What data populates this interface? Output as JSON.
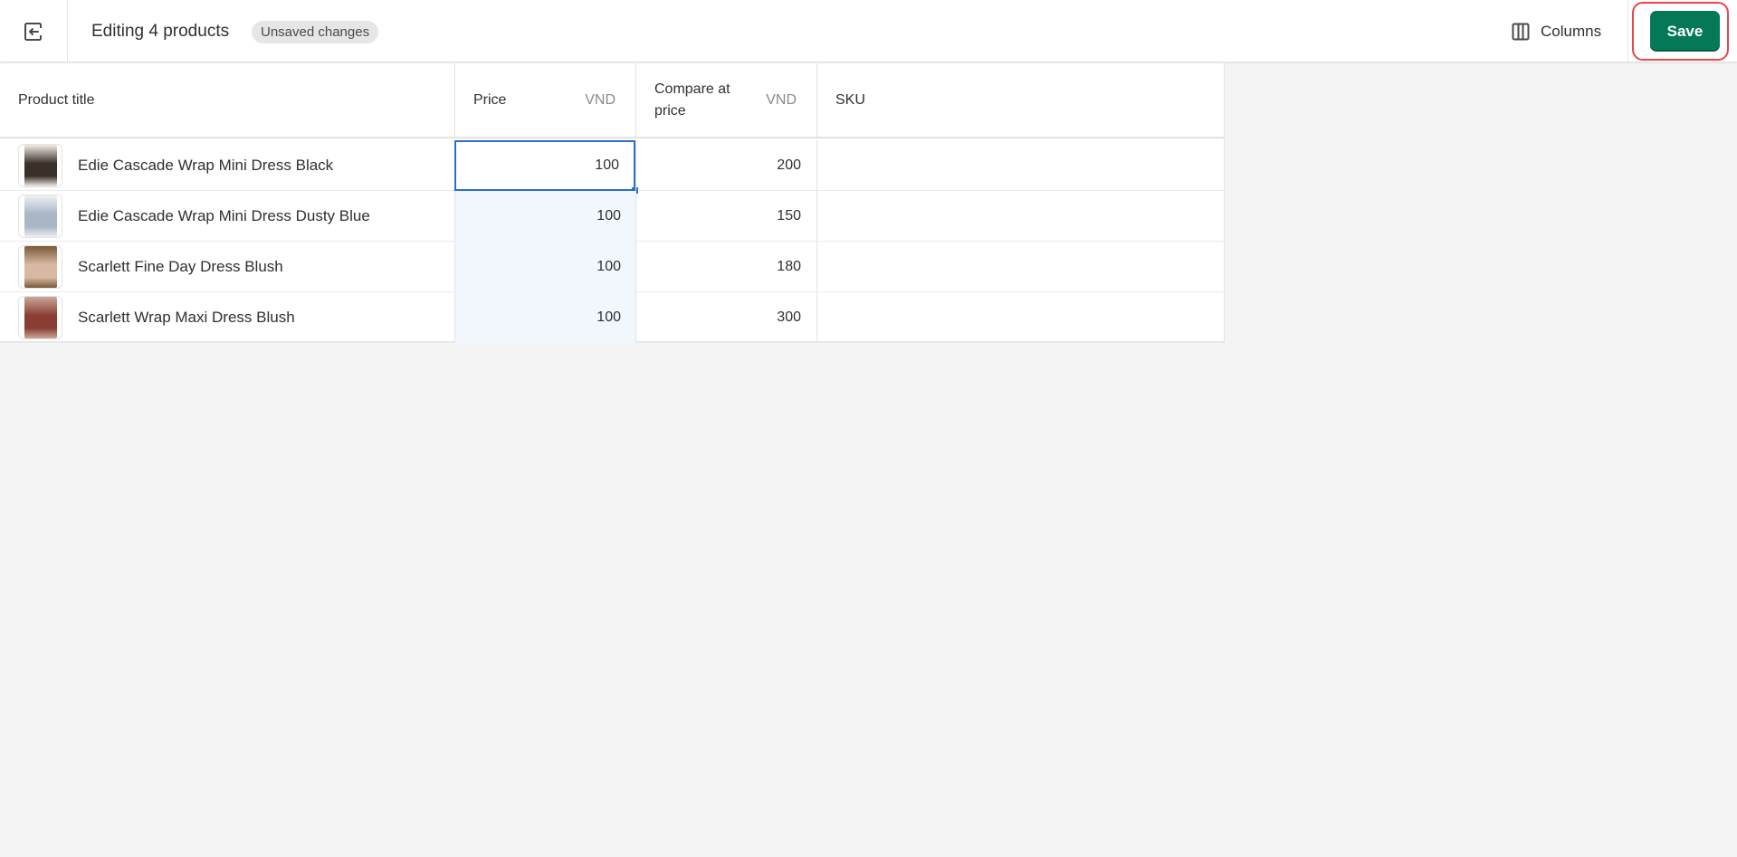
{
  "header": {
    "back_icon": "exit-arrow-icon",
    "title": "Editing 4 products",
    "badge": "Unsaved changes",
    "columns_icon": "columns-icon",
    "columns_label": "Columns",
    "save_label": "Save"
  },
  "colors": {
    "save_button": "#047857",
    "highlight_outline": "#e5484d",
    "selection": "#2c6ecb",
    "selected_column_bg": "#f2f7fe"
  },
  "table": {
    "columns": [
      {
        "label": "Product title",
        "unit": ""
      },
      {
        "label": "Price",
        "unit": "VND"
      },
      {
        "label": "Compare at price",
        "unit": "VND"
      },
      {
        "label": "SKU",
        "unit": ""
      }
    ],
    "rows": [
      {
        "title": "Edie Cascade Wrap Mini Dress Black",
        "price": "100",
        "compare_at": "200",
        "sku": "",
        "thumb_colors": [
          "#f2ede6",
          "#3a302a"
        ]
      },
      {
        "title": "Edie Cascade Wrap Mini Dress Dusty Blue",
        "price": "100",
        "compare_at": "150",
        "sku": "",
        "thumb_colors": [
          "#eef0f3",
          "#a9b6c6"
        ]
      },
      {
        "title": "Scarlett Fine Day Dress Blush",
        "price": "100",
        "compare_at": "180",
        "sku": "",
        "thumb_colors": [
          "#7a5a3a",
          "#d9b9a3"
        ]
      },
      {
        "title": "Scarlett Wrap Maxi Dress Blush",
        "price": "100",
        "compare_at": "300",
        "sku": "",
        "thumb_colors": [
          "#c9a89a",
          "#8a3d33"
        ]
      }
    ],
    "selected_cell": {
      "row": 0,
      "column": "price"
    }
  }
}
